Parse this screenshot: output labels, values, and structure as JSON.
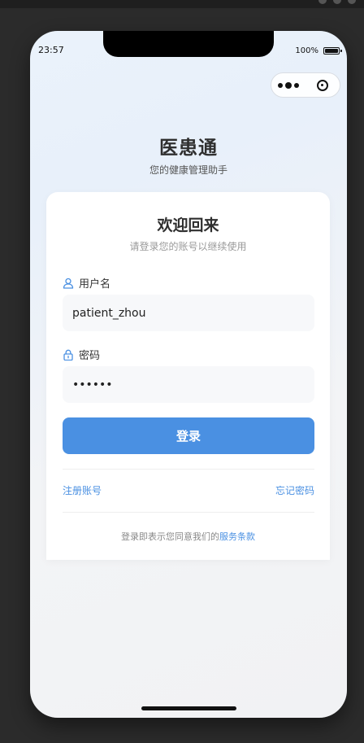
{
  "status_bar": {
    "time": "23:57",
    "battery": "100%"
  },
  "app": {
    "title": "医患通",
    "subtitle": "您的健康管理助手"
  },
  "login_card": {
    "title": "欢迎回来",
    "subtitle": "请登录您的账号以继续使用",
    "username": {
      "label": "用户名",
      "value": "patient_zhou",
      "icon": "user-icon"
    },
    "password": {
      "label": "密码",
      "value": "••••••",
      "icon": "lock-icon"
    },
    "login_button": "登录",
    "register_link": "注册账号",
    "forgot_link": "忘记密码",
    "terms_text": "登录即表示您同意我们的",
    "terms_link": "服务条款"
  },
  "colors": {
    "accent": "#4a90e2",
    "title": "#2f2f2f"
  }
}
